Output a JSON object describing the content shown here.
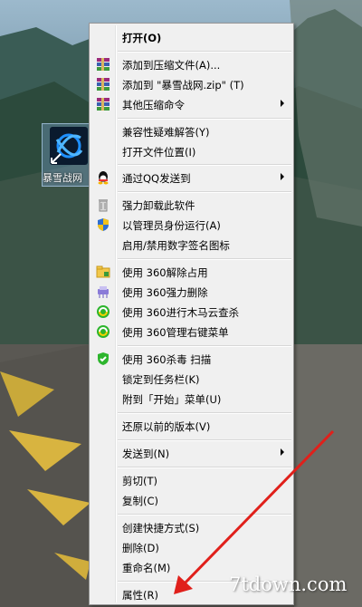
{
  "desktop": {
    "icon_label": "暴雪战网"
  },
  "menu": {
    "items": [
      {
        "label": "打开(O)",
        "icon": "none",
        "bold": true
      },
      {
        "label": "添加到压缩文件(A)...",
        "icon": "winrar-icon"
      },
      {
        "label": "添加到 \"暴雪战网.zip\" (T)",
        "icon": "winrar-icon"
      },
      {
        "label": "其他压缩命令",
        "icon": "winrar-icon",
        "submenu": true
      },
      {
        "label": "兼容性疑难解答(Y)",
        "icon": "none"
      },
      {
        "label": "打开文件位置(I)",
        "icon": "none"
      },
      {
        "label": "通过QQ发送到",
        "icon": "qq-icon",
        "submenu": true
      },
      {
        "label": "强力卸载此软件",
        "icon": "trash-icon"
      },
      {
        "label": "以管理员身份运行(A)",
        "icon": "uac-shield-icon"
      },
      {
        "label": "启用/禁用数字签名图标",
        "icon": "none"
      },
      {
        "label": "使用 360解除占用",
        "icon": "folder-icon"
      },
      {
        "label": "使用 360强力删除",
        "icon": "shredder-icon"
      },
      {
        "label": "使用 360进行木马云查杀",
        "icon": "360-icon"
      },
      {
        "label": "使用 360管理右键菜单",
        "icon": "360-icon"
      },
      {
        "label": "使用 360杀毒 扫描",
        "icon": "360-shield-icon"
      },
      {
        "label": "锁定到任务栏(K)",
        "icon": "none"
      },
      {
        "label": "附到「开始」菜单(U)",
        "icon": "none"
      },
      {
        "label": "还原以前的版本(V)",
        "icon": "none"
      },
      {
        "label": "发送到(N)",
        "icon": "none",
        "submenu": true
      },
      {
        "label": "剪切(T)",
        "icon": "none"
      },
      {
        "label": "复制(C)",
        "icon": "none"
      },
      {
        "label": "创建快捷方式(S)",
        "icon": "none"
      },
      {
        "label": "删除(D)",
        "icon": "none"
      },
      {
        "label": "重命名(M)",
        "icon": "none"
      },
      {
        "label": "属性(R)",
        "icon": "none"
      }
    ]
  },
  "watermark": "7tdown.com"
}
